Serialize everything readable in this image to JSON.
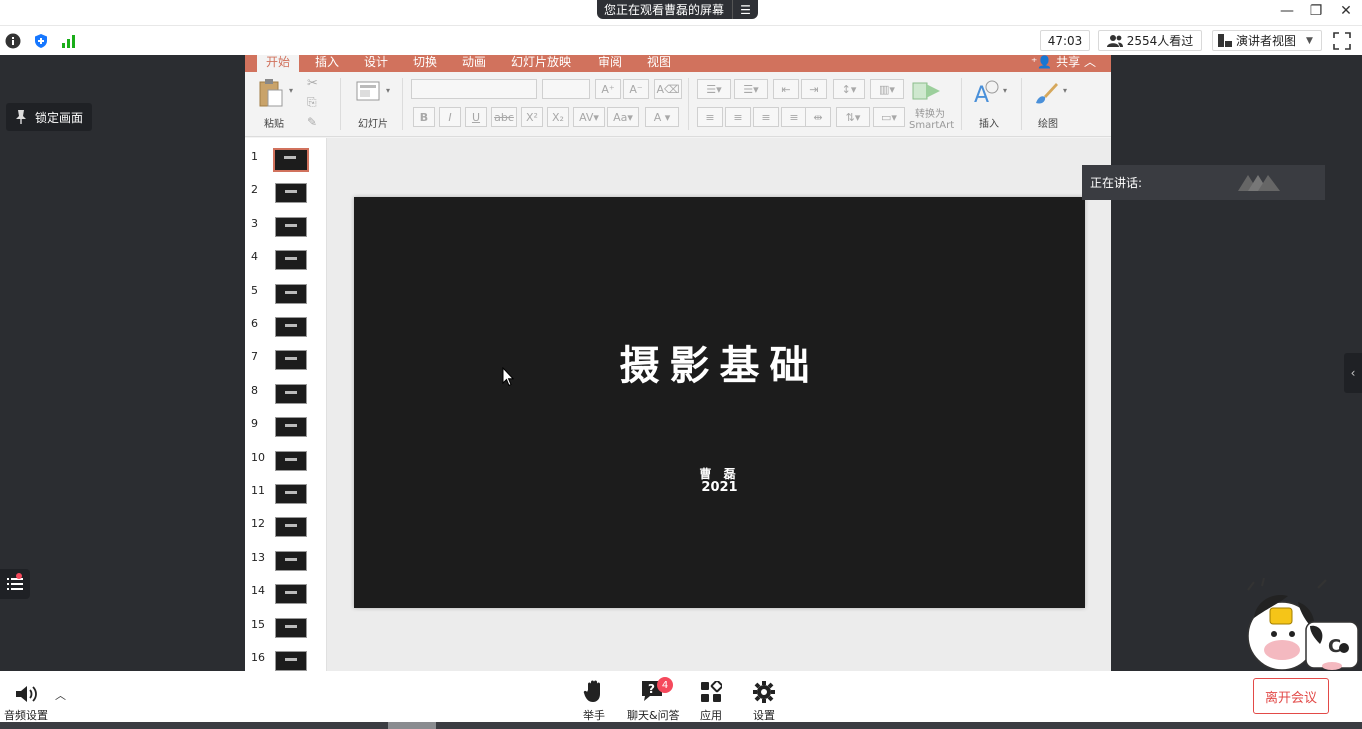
{
  "titlebar": {
    "share_notice": "您正在观看曹磊的屏幕",
    "menu_glyph": "☰",
    "minimize": "—",
    "restore": "❐",
    "close": "✕"
  },
  "status": {
    "timer": "47:03",
    "viewers": "2554人看过",
    "view_mode": "演讲者视图"
  },
  "stage": {
    "lock_label": "锁定画面",
    "speaking_label": "正在讲话:"
  },
  "ppt": {
    "tabs": [
      "开始",
      "插入",
      "设计",
      "切换",
      "动画",
      "幻灯片放映",
      "审阅",
      "视图"
    ],
    "share_label": "共享",
    "ribbon": {
      "paste": "粘贴",
      "slide": "幻灯片",
      "convert_line1": "转换为",
      "convert_line2": "SmartArt",
      "insert": "插入",
      "draw": "绘图"
    },
    "thumbnails": [
      "1",
      "2",
      "3",
      "4",
      "5",
      "6",
      "7",
      "8",
      "9",
      "10",
      "11",
      "12",
      "13",
      "14",
      "15",
      "16"
    ],
    "slide": {
      "title": "摄影基础",
      "author": "曹 磊",
      "year": "2021"
    }
  },
  "toolbar": {
    "audio": "音频设置",
    "raise_hand": "举手",
    "chat": "聊天&问答",
    "chat_badge": "4",
    "apps": "应用",
    "settings": "设置",
    "leave": "离开会议"
  },
  "colors": {
    "ppt_accent": "#d1725d",
    "leave_red": "#e24a48",
    "badge_red": "#f5495c",
    "stage_bg": "#2b2d31"
  }
}
